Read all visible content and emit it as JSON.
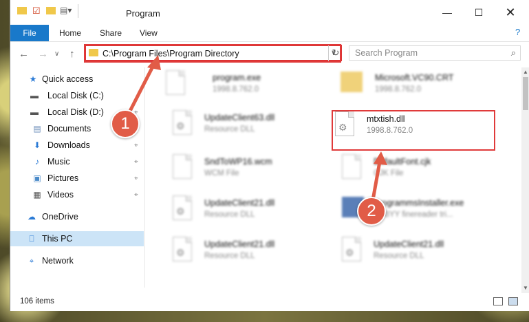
{
  "window": {
    "title": "Program"
  },
  "ribbon": {
    "file": "File",
    "home": "Home",
    "share": "Share",
    "view": "View"
  },
  "address": {
    "path": "C:\\Program Files\\Program Directory"
  },
  "search": {
    "placeholder": "Search Program"
  },
  "sidebar": {
    "items": [
      {
        "label": "Quick access",
        "icon": "star-icon"
      },
      {
        "label": "Local Disk (C:)",
        "icon": "drive-icon"
      },
      {
        "label": "Local Disk (D:)",
        "icon": "drive-icon"
      },
      {
        "label": "Documents",
        "icon": "documents-icon"
      },
      {
        "label": "Downloads",
        "icon": "download-icon"
      },
      {
        "label": "Music",
        "icon": "music-icon"
      },
      {
        "label": "Pictures",
        "icon": "pictures-icon"
      },
      {
        "label": "Videos",
        "icon": "videos-icon"
      },
      {
        "label": "OneDrive",
        "icon": "cloud-icon"
      },
      {
        "label": "This PC",
        "icon": "computer-icon"
      },
      {
        "label": "Network",
        "icon": "network-icon"
      }
    ]
  },
  "files": [
    {
      "name": "program.exe",
      "sub": "1998.8.762.0"
    },
    {
      "name": "Microsoft.VC90.CRT",
      "sub": "1998.8.762.0"
    },
    {
      "name": "UpdateClient63.dll",
      "sub": "Resource DLL"
    },
    {
      "name": "mtxtish.dll",
      "sub": "1998.8.762.0"
    },
    {
      "name": "SndToWP16.wcm",
      "sub": "WCM File"
    },
    {
      "name": "DefaultFont.cjk",
      "sub": "CJK File"
    },
    {
      "name": "UpdateClient21.dll",
      "sub": "Resource DLL"
    },
    {
      "name": "ProgrammsInstaller.exe",
      "sub": "ABBYY finereader tri..."
    },
    {
      "name": "UpdateClient21.dll",
      "sub": "Resource DLL"
    },
    {
      "name": "UpdateClient21.dll",
      "sub": "Resource DLL"
    }
  ],
  "status": {
    "items": "106 items"
  },
  "annotations": {
    "step1": "1",
    "step2": "2"
  },
  "colors": {
    "accent": "#1979ca",
    "highlight": "#e03a3a",
    "badge": "#e15c47"
  }
}
